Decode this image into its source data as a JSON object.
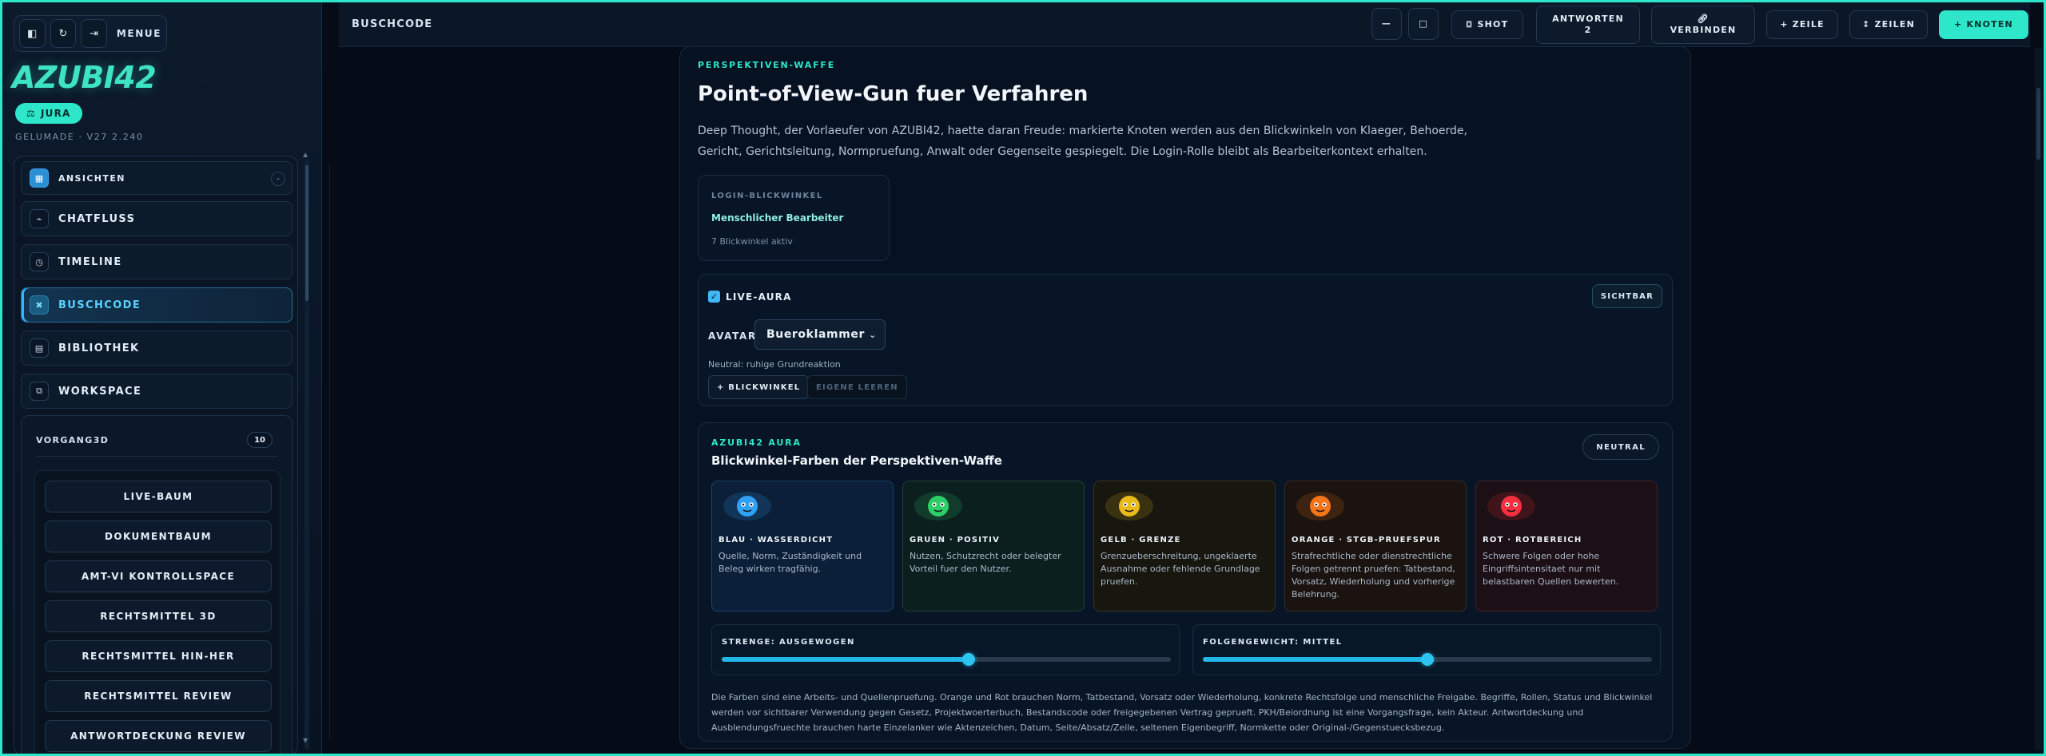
{
  "sidebar": {
    "menu_label": "MENUE",
    "logo": "AZUBI42",
    "badge": "JURA",
    "version": "GELUMADE · V27 2.240",
    "nav": [
      {
        "label": "ANSICHTEN",
        "icon": "grid-icon"
      },
      {
        "label": "CHATFLUSS",
        "icon": "chat-flow-icon"
      },
      {
        "label": "TIMELINE",
        "icon": "clock-icon"
      },
      {
        "label": "BUSCHCODE",
        "icon": "code-node-icon"
      },
      {
        "label": "BIBLIOTHEK",
        "icon": "library-icon"
      },
      {
        "label": "WORKSPACE",
        "icon": "workspace-icon"
      }
    ],
    "collapse_symbol": "-",
    "vorgang": {
      "title": "VORGANG3D",
      "count": "10",
      "items": [
        "LIVE-BAUM",
        "DOKUMENTBAUM",
        "AMT-VI KONTROLLSPACE",
        "RECHTSMITTEL 3D",
        "RECHTSMITTEL HIN-HER",
        "RECHTSMITTEL REVIEW",
        "ANTWORTDECKUNG REVIEW"
      ]
    }
  },
  "topbar": {
    "crumb": "BUSCHCODE",
    "shot": "SHOT",
    "antworten_line1": "ANTWORTEN",
    "antworten_line2": "2",
    "verbinden": "VERBINDEN",
    "zeile": "+ ZEILE",
    "zeilen": "↕ ZEILEN",
    "knoten": "+ KNOTEN"
  },
  "main": {
    "kicker": "PERSPEKTIVEN-WAFFE",
    "title": "Point-of-View-Gun fuer Verfahren",
    "intro": "Deep Thought, der Vorlaeufer von AZUBI42, haette daran Freude: markierte Knoten werden aus den Blickwinkeln von Klaeger, Behoerde, Gericht, Gerichtsleitung, Normpruefung, Anwalt oder Gegenseite gespiegelt. Die Login-Rolle bleibt als Bearbeiterkontext erhalten.",
    "login": {
      "label": "LOGIN-BLICKWINKEL",
      "value": "Menschlicher Bearbeiter",
      "status": "7 Blickwinkel aktiv"
    },
    "live": {
      "label": "LIVE-AURA",
      "checked": true,
      "visible_button": "SICHTBAR",
      "avatar_label": "AVATAR",
      "avatar_value": "Bueroklammer",
      "neutral_note": "Neutral: ruhige Grundreaktion",
      "add_button": "+ BLICKWINKEL",
      "clear_button": "EIGENE LEEREN"
    },
    "aura": {
      "kicker": "AZUBI42 AURA",
      "title": "Blickwinkel-Farben der Perspektiven-Waffe",
      "state": "NEUTRAL",
      "tiles": [
        {
          "title": "BLAU · WASSERDICHT",
          "text": "Quelle, Norm, Zuständigkeit und Beleg wirken tragfähig.",
          "color": "#31a8ff",
          "bg": "#0b1f38",
          "border": "#1c416a"
        },
        {
          "title": "GRUEN · POSITIV",
          "text": "Nutzen, Schutzrecht oder belegter Vorteil fuer den Nutzer.",
          "color": "#2fd66b",
          "bg": "#0b1f1f",
          "border": "#1c4236"
        },
        {
          "title": "GELB · GRENZE",
          "text": "Grenzueberschreitung, ungeklaerte Ausnahme oder fehlende Grundlage pruefen.",
          "color": "#f2c21a",
          "bg": "#17160f",
          "border": "#3b3420"
        },
        {
          "title": "ORANGE · STGB-PRUEFSPUR",
          "text": "Strafrechtliche oder dienstrechtliche Folgen getrennt pruefen: Tatbestand, Vorsatz, Wiederholung und vorherige Belehrung.",
          "color": "#ff7a1a",
          "bg": "#1a130f",
          "border": "#3d2a1f"
        },
        {
          "title": "ROT · ROTBEREICH",
          "text": "Schwere Folgen oder hohe Eingriffsintensitaet nur mit belastbaren Quellen bewerten.",
          "color": "#ff3040",
          "bg": "#1d0f16",
          "border": "#44202c"
        }
      ],
      "sliders": [
        {
          "label": "STRENGE: AUSGEWOGEN",
          "value": 0.55
        },
        {
          "label": "FOLGENGEWICHT: MITTEL",
          "value": 0.5
        }
      ],
      "footnote": "Die Farben sind eine Arbeits- und Quellenpruefung. Orange und Rot brauchen Norm, Tatbestand, Vorsatz oder Wiederholung, konkrete Rechtsfolge und menschliche Freigabe. Begriffe, Rollen, Status und Blickwinkel werden vor sichtbarer Verwendung gegen Gesetz, Projektwoerterbuch, Bestandscode oder freigegebenen Vertrag geprueft. PKH/Beiordnung ist eine Vorgangsfrage, kein Akteur. Antwortdeckung und Ausblendungsfruechte brauchen harte Einzelanker wie Aktenzeichen, Datum, Seite/Absatz/Zeile, seltenen Eigenbegriff, Normkette oder Original-/Gegenstuecksbezug."
    }
  },
  "colors": {
    "accent": "#2ee6c9",
    "active_nav": "#5ad0ff",
    "background": "#050b17"
  }
}
